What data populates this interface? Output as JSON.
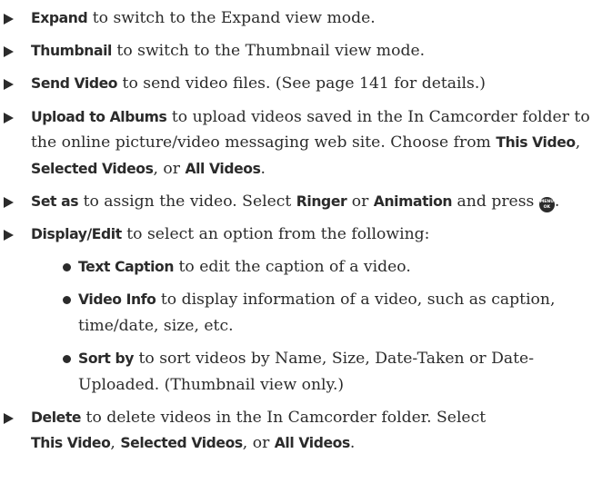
{
  "items": [
    {
      "b1": "Expand",
      "t1": " to switch to the Expand view mode."
    },
    {
      "b1": "Thumbnail",
      "t1": " to switch to the Thumbnail view mode."
    },
    {
      "b1": "Send Video",
      "t1": " to send video files. (See page 141 for details.)"
    },
    {
      "b1": "Upload to Albums",
      "t1": " to upload videos saved in the In Camcorder folder to the online picture/video messaging web site. Choose from ",
      "b2": "This Video",
      "t2": ", ",
      "b3": "Selected Videos",
      "t3": ", or ",
      "b4": "All Videos",
      "t4": "."
    },
    {
      "b1": "Set as",
      "t1": " to assign the video. Select ",
      "b2": "Ringer",
      "t2": " or ",
      "b3": "Animation",
      "t3": " and press ",
      "t4": "."
    },
    {
      "b1": "Display/Edit",
      "t1": " to select an option from the following:"
    },
    {
      "b1": "Delete",
      "t1": " to delete videos in the In Camcorder folder. Select ",
      "b2": "This Video",
      "t2": ", ",
      "b3": "Selected Videos",
      "t3": ", or ",
      "b4": "All Videos",
      "t4": "."
    }
  ],
  "subitems": [
    {
      "b": "Text Caption",
      "t": " to edit the caption of a video."
    },
    {
      "b": "Video Info",
      "t": " to display information of a video, such as caption, time/date, size, etc."
    },
    {
      "b": "Sort by",
      "t": " to sort videos by Name, Size, Date-Taken or Date-Uploaded. (Thumbnail view only.)"
    }
  ],
  "menu_key": {
    "line1": "MENU",
    "line2": "OK",
    "icon": "menu-ok-key-icon"
  }
}
